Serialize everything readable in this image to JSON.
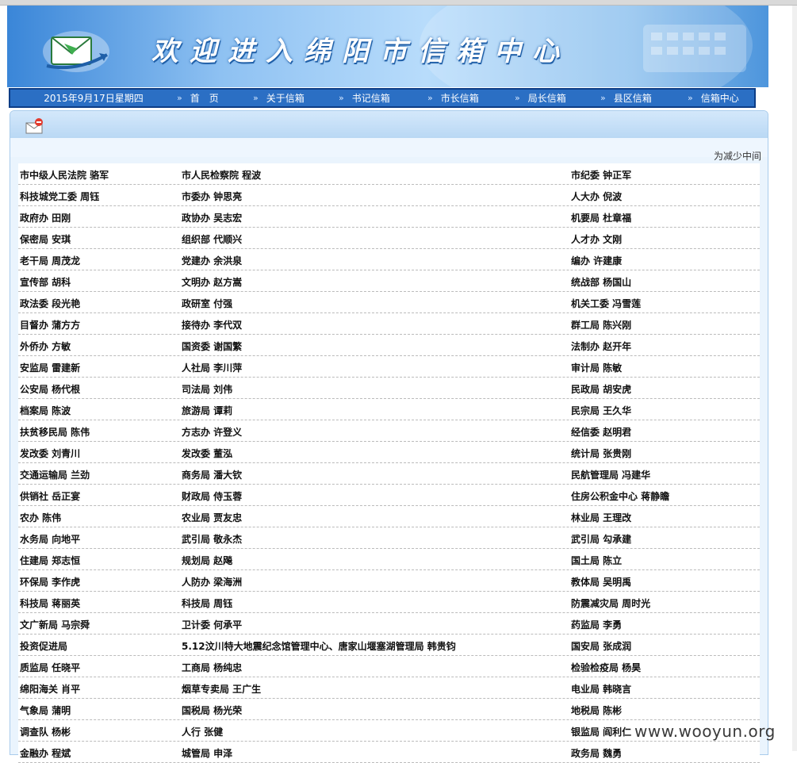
{
  "banner": {
    "title": "欢迎进入绵阳市信箱中心"
  },
  "nav": {
    "date": "2015年9月17日星期四",
    "items": [
      "首　页",
      "关于信箱",
      "书记信箱",
      "市长信箱",
      "局长信箱",
      "县区信箱",
      "信箱中心"
    ],
    "arrow": "»"
  },
  "content": {
    "marquee": "为减少中间"
  },
  "rows": [
    [
      "市中级人民法院 骆军",
      "市人民检察院 程波",
      "市纪委 钟正军"
    ],
    [
      "科技城党工委 周钰",
      "市委办 钟思亮",
      "人大办 倪波"
    ],
    [
      "政府办 田刚",
      "政协办 吴志宏",
      "机要局 杜章福"
    ],
    [
      "保密局 安琪",
      "组织部 代顺兴",
      "人才办 文刚"
    ],
    [
      "老干局 周茂龙",
      "党建办 余洪泉",
      "编办 许建康"
    ],
    [
      "宣传部 胡科",
      "文明办 赵方嵩",
      "统战部 杨国山"
    ],
    [
      "政法委 段光艳",
      "政研室 付强",
      "机关工委 冯雪莲"
    ],
    [
      "目督办 蒲方方",
      "接待办 李代双",
      "群工局 陈兴刚"
    ],
    [
      "外侨办 方敏",
      "国资委 谢国繁",
      "法制办 赵开年"
    ],
    [
      "安监局 雷建新",
      "人社局 李川萍",
      "审计局 陈敏"
    ],
    [
      "公安局 杨代根",
      "司法局 刘伟",
      "民政局 胡安虎"
    ],
    [
      "档案局 陈波",
      "旅游局 谭莉",
      "民宗局 王久华"
    ],
    [
      "扶贫移民局 陈伟",
      "方志办 许登义",
      "经信委 赵明君"
    ],
    [
      "发改委 刘青川",
      "发改委 董泓",
      "统计局 张贵刚"
    ],
    [
      "交通运输局 兰劲",
      "商务局 潘大钦",
      "民航管理局 冯建华"
    ],
    [
      "供销社 岳正宴",
      "财政局 侍玉蓉",
      "住房公积金中心 蒋静瞻"
    ],
    [
      "农办 陈伟",
      "农业局 贾友忠",
      "林业局 王理改"
    ],
    [
      "水务局 向地平",
      "武引局 敬永杰",
      "武引局 勾承建"
    ],
    [
      "住建局 郑志恒",
      "规划局 赵飚",
      "国土局 陈立"
    ],
    [
      "环保局 李作虎",
      "人防办 梁海洲",
      "教体局 吴明禹"
    ],
    [
      "科技局 蒋丽英",
      "科技局 周钰",
      "防震减灾局 周时光"
    ],
    [
      "文广新局 马宗舜",
      "卫计委 何承平",
      "药监局 李勇"
    ],
    [
      "投资促进局",
      "5.12汶川特大地震纪念馆管理中心、唐家山堰塞湖管理局 韩贵钧",
      "国安局 张成润"
    ],
    [
      "质监局 任晓平",
      "工商局 杨纯忠",
      "检验检疫局 杨昊"
    ],
    [
      "绵阳海关 肖平",
      "烟草专卖局 王广生",
      "电业局 韩晓言"
    ],
    [
      "气象局 蒲明",
      "国税局 杨光荣",
      "地税局 陈彬"
    ],
    [
      "调查队 杨彬",
      "人行 张健",
      "银监局 阎利仁"
    ],
    [
      "金融办 程斌",
      "城管局 申泽",
      "政务局 魏勇"
    ]
  ],
  "watermark": "www.wooyun.org"
}
